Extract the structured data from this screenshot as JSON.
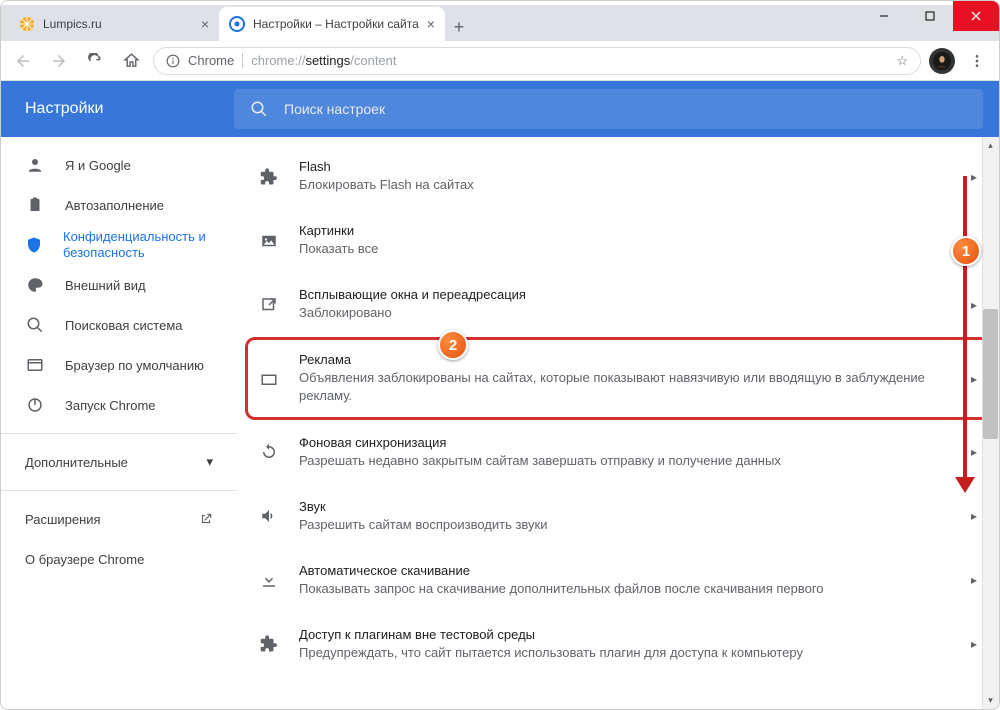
{
  "window": {
    "tabs": [
      {
        "label": "Lumpics.ru"
      },
      {
        "label": "Настройки – Настройки сайта"
      }
    ],
    "address_chip": "Chrome",
    "address_prefix": "chrome://",
    "address_mid": "settings",
    "address_suffix": "/content"
  },
  "app": {
    "title": "Настройки",
    "search_placeholder": "Поиск настроек"
  },
  "sidebar": {
    "items": [
      {
        "label": "Я и Google"
      },
      {
        "label": "Автозаполнение"
      },
      {
        "label": "Конфиденциальность и безопасность"
      },
      {
        "label": "Внешний вид"
      },
      {
        "label": "Поисковая система"
      },
      {
        "label": "Браузер по умолчанию"
      },
      {
        "label": "Запуск Chrome"
      }
    ],
    "advanced": "Дополнительные",
    "extensions": "Расширения",
    "about": "О браузере Chrome"
  },
  "rows": [
    {
      "title": "Flash",
      "sub": "Блокировать Flash на сайтах"
    },
    {
      "title": "Картинки",
      "sub": "Показать все"
    },
    {
      "title": "Всплывающие окна и переадресация",
      "sub": "Заблокировано"
    },
    {
      "title": "Реклама",
      "sub": "Объявления заблокированы на сайтах, которые показывают навязчивую или вводящую в заблуждение рекламу."
    },
    {
      "title": "Фоновая синхронизация",
      "sub": "Разрешать недавно закрытым сайтам завершать отправку и получение данных"
    },
    {
      "title": "Звук",
      "sub": "Разрешить сайтам воспроизводить звуки"
    },
    {
      "title": "Автоматическое скачивание",
      "sub": "Показывать запрос на скачивание дополнительных файлов после скачивания первого"
    },
    {
      "title": "Доступ к плагинам вне тестовой среды",
      "sub": "Предупреждать, что сайт пытается использовать плагин для доступа к компьютеру"
    }
  ],
  "annotations": {
    "b1": "1",
    "b2": "2"
  }
}
